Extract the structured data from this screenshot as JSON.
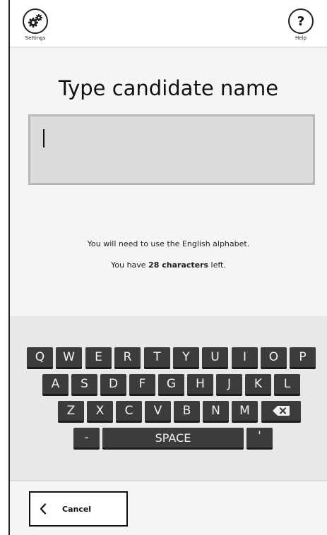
{
  "header": {
    "settings_label": "Settings",
    "help_label": "Help",
    "help_glyph": "?"
  },
  "main": {
    "title": "Type candidate name",
    "input_value": "",
    "info_alphabet": "You will need to use the English alphabet.",
    "info_prefix": "You have ",
    "chars_left": "28 characters",
    "info_suffix": " left."
  },
  "keyboard": {
    "row1": [
      "Q",
      "W",
      "E",
      "R",
      "T",
      "Y",
      "U",
      "I",
      "O",
      "P"
    ],
    "row2": [
      "A",
      "S",
      "D",
      "F",
      "G",
      "H",
      "J",
      "K",
      "L"
    ],
    "row3": [
      "Z",
      "X",
      "C",
      "V",
      "B",
      "N",
      "M"
    ],
    "hyphen": "-",
    "space": "SPACE",
    "apostrophe": "'",
    "backspace_icon": "backspace-icon"
  },
  "footer": {
    "cancel_label": "Cancel"
  }
}
